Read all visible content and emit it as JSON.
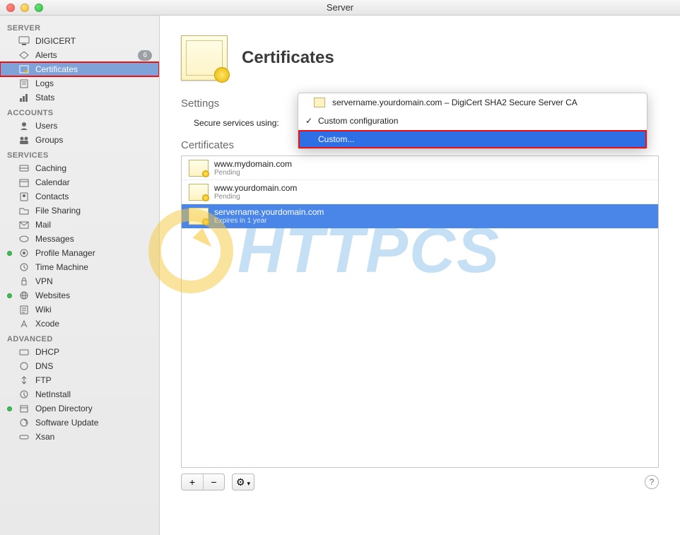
{
  "window": {
    "title": "Server"
  },
  "sidebar": {
    "sections": [
      {
        "title": "SERVER",
        "items": [
          {
            "label": "DIGICERT",
            "icon": "monitor"
          },
          {
            "label": "Alerts",
            "icon": "alert",
            "badge": "6"
          },
          {
            "label": "Certificates",
            "icon": "cert",
            "selected": true,
            "highlight": true
          },
          {
            "label": "Logs",
            "icon": "logs"
          },
          {
            "label": "Stats",
            "icon": "stats"
          }
        ]
      },
      {
        "title": "ACCOUNTS",
        "items": [
          {
            "label": "Users",
            "icon": "user"
          },
          {
            "label": "Groups",
            "icon": "group"
          }
        ]
      },
      {
        "title": "SERVICES",
        "items": [
          {
            "label": "Caching",
            "icon": "caching"
          },
          {
            "label": "Calendar",
            "icon": "calendar"
          },
          {
            "label": "Contacts",
            "icon": "contacts"
          },
          {
            "label": "File Sharing",
            "icon": "fileshare"
          },
          {
            "label": "Mail",
            "icon": "mail"
          },
          {
            "label": "Messages",
            "icon": "messages"
          },
          {
            "label": "Profile Manager",
            "icon": "profile",
            "dot": true
          },
          {
            "label": "Time Machine",
            "icon": "timemachine"
          },
          {
            "label": "VPN",
            "icon": "vpn"
          },
          {
            "label": "Websites",
            "icon": "websites",
            "dot": true
          },
          {
            "label": "Wiki",
            "icon": "wiki"
          },
          {
            "label": "Xcode",
            "icon": "xcode"
          }
        ]
      },
      {
        "title": "ADVANCED",
        "items": [
          {
            "label": "DHCP",
            "icon": "dhcp"
          },
          {
            "label": "DNS",
            "icon": "dns"
          },
          {
            "label": "FTP",
            "icon": "ftp"
          },
          {
            "label": "NetInstall",
            "icon": "netinstall"
          },
          {
            "label": "Open Directory",
            "icon": "opendir",
            "dot": true
          },
          {
            "label": "Software Update",
            "icon": "swupdate"
          },
          {
            "label": "Xsan",
            "icon": "xsan"
          }
        ]
      }
    ]
  },
  "header": {
    "title": "Certificates"
  },
  "settings": {
    "title": "Settings",
    "label": "Secure services using:"
  },
  "dropdown": {
    "options": [
      {
        "label": "servername.yourdomain.com – DigiCert SHA2 Secure Server CA",
        "icon": true
      },
      {
        "label": "Custom configuration",
        "checked": true
      },
      {
        "label": "Custom...",
        "selected": true,
        "highlight": true
      }
    ]
  },
  "certs": {
    "title": "Certificates",
    "items": [
      {
        "name": "www.mydomain.com",
        "status": "Pending"
      },
      {
        "name": "www.yourdomain.com",
        "status": "Pending"
      },
      {
        "name": "servername.yourdomain.com",
        "status": "Expires in 1 year",
        "selected": true
      }
    ]
  },
  "toolbar": {
    "add": "+",
    "remove": "−",
    "gear": "⚙",
    "gear_arrow": "▾",
    "help": "?"
  },
  "watermark": "HTTPCS"
}
